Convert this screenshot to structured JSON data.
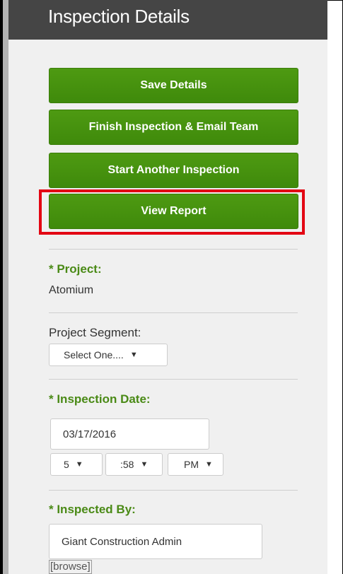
{
  "header": {
    "title": "Inspection Details"
  },
  "buttons": {
    "save": "Save Details",
    "finish": "Finish Inspection & Email Team",
    "start_another": "Start Another Inspection",
    "view_report": "View Report"
  },
  "project": {
    "label": "* Project:",
    "value": "Atomium"
  },
  "segment": {
    "label": "Project Segment:",
    "selected": "Select One...."
  },
  "inspection_date": {
    "label": "* Inspection Date:",
    "date": "03/17/2016",
    "hour": "5",
    "minute": ":58",
    "ampm": "PM"
  },
  "inspected_by": {
    "label": "* Inspected By:",
    "value": "Giant Construction Admin",
    "browse_link": "[browse]"
  },
  "icons": {
    "dropdown_arrow": "▼"
  },
  "colors": {
    "accent_green": "#3f8a0b",
    "label_green": "#4a8a16",
    "highlight_red": "#e30613",
    "header_bg": "#454545"
  }
}
